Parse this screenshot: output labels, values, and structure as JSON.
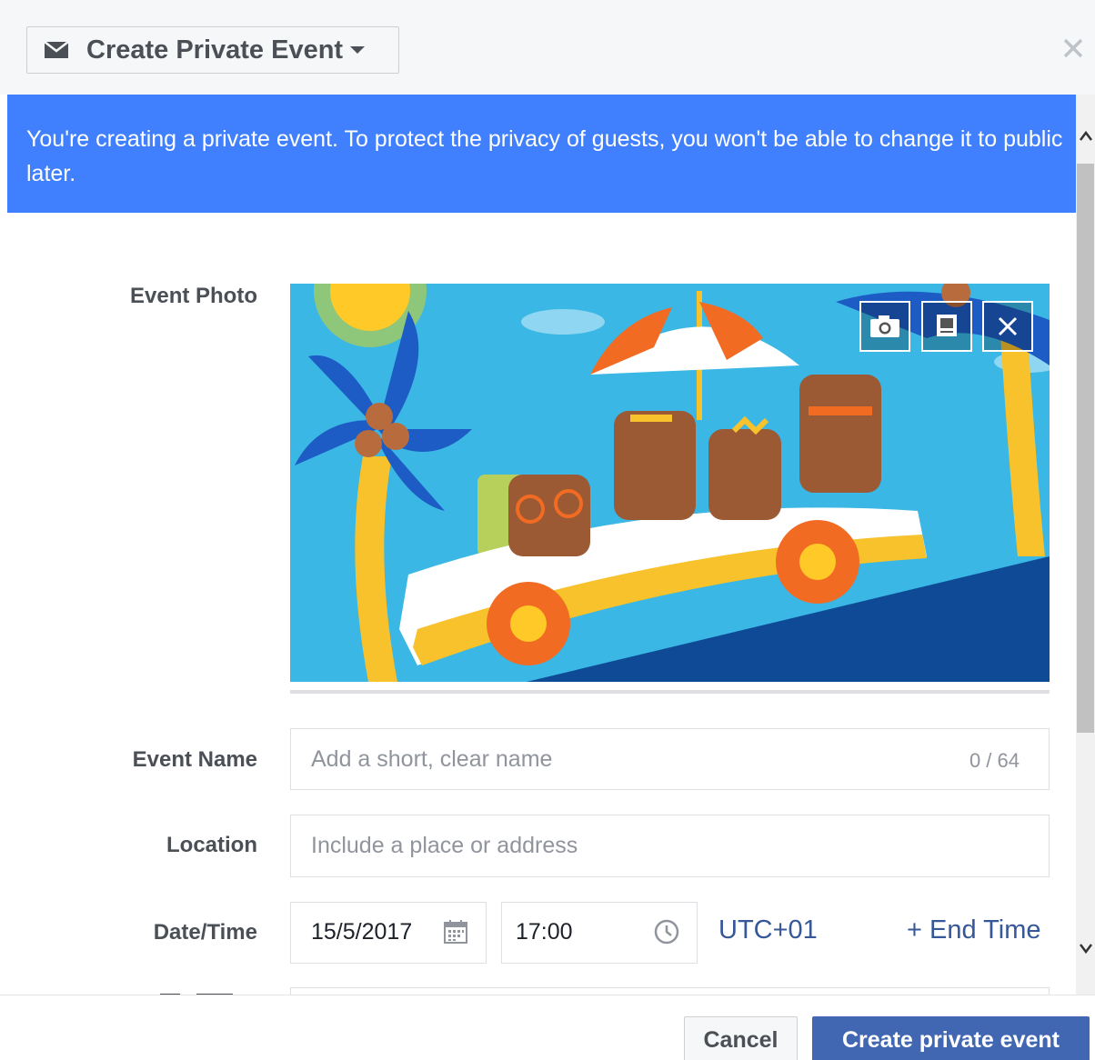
{
  "dialog": {
    "type_selector_label": "Create Private Event",
    "close_icon": "close-icon"
  },
  "banner": {
    "text": "You're creating a private event. To protect the privacy of guests, you won't be able to change it to public later.",
    "color": "#4080ff"
  },
  "form": {
    "photo_label": "Event Photo",
    "photo_buttons": [
      "camera-icon",
      "theme-icon",
      "remove-icon"
    ],
    "name_label": "Event Name",
    "name_placeholder": "Add a short, clear name",
    "name_counter": "0 / 64",
    "location_label": "Location",
    "location_placeholder": "Include a place or address",
    "datetime_label": "Date/Time",
    "date_value": "15/5/2017",
    "time_value": "17:00",
    "timezone": "UTC+01",
    "end_time_link": "+ End Time"
  },
  "footer": {
    "cancel_label": "Cancel",
    "create_label": "Create private event",
    "primary_color": "#4267b2"
  }
}
